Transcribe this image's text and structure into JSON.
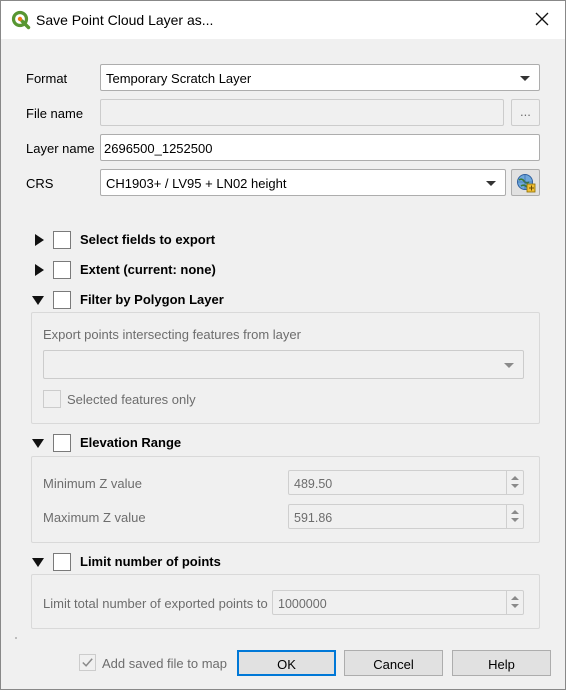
{
  "window": {
    "title": "Save Point Cloud Layer as...",
    "app_icon": "qgis-logo-icon",
    "close_icon": "close-icon"
  },
  "form": {
    "format_label": "Format",
    "format_value": "Temporary Scratch Layer",
    "file_name_label": "File name",
    "file_name_value": "",
    "browse_label": "...",
    "layer_name_label": "Layer name",
    "layer_name_value": "2696500_1252500",
    "crs_label": "CRS",
    "crs_value": "CH1903+ / LV95 + LN02 height",
    "crs_button_icon": "crs-select-icon"
  },
  "groups": {
    "select_fields": {
      "title": "Select fields to export",
      "expanded": false,
      "checked": false
    },
    "extent": {
      "title": "Extent (current: none)",
      "expanded": false,
      "checked": false
    },
    "filter_polygon": {
      "title": "Filter by Polygon Layer",
      "expanded": true,
      "checked": false,
      "layer_label": "Export points intersecting features from layer",
      "layer_value": "",
      "selected_only_label": "Selected features only"
    },
    "elevation": {
      "title": "Elevation Range",
      "expanded": true,
      "checked": false,
      "min_label": "Minimum Z value",
      "min_value": "489.50",
      "max_label": "Maximum Z value",
      "max_value": "591.86"
    },
    "limit_points": {
      "title": "Limit number of points",
      "expanded": true,
      "checked": false,
      "limit_label": "Limit total number of exported points to",
      "limit_value": "1000000"
    }
  },
  "footer": {
    "add_to_map_label": "Add saved file to map",
    "add_to_map_checked": true,
    "ok": "OK",
    "cancel": "Cancel",
    "help": "Help"
  },
  "colors": {
    "accent": "#0078d7",
    "qgis_green": "#589632",
    "qgis_yellow": "#ee7913"
  }
}
